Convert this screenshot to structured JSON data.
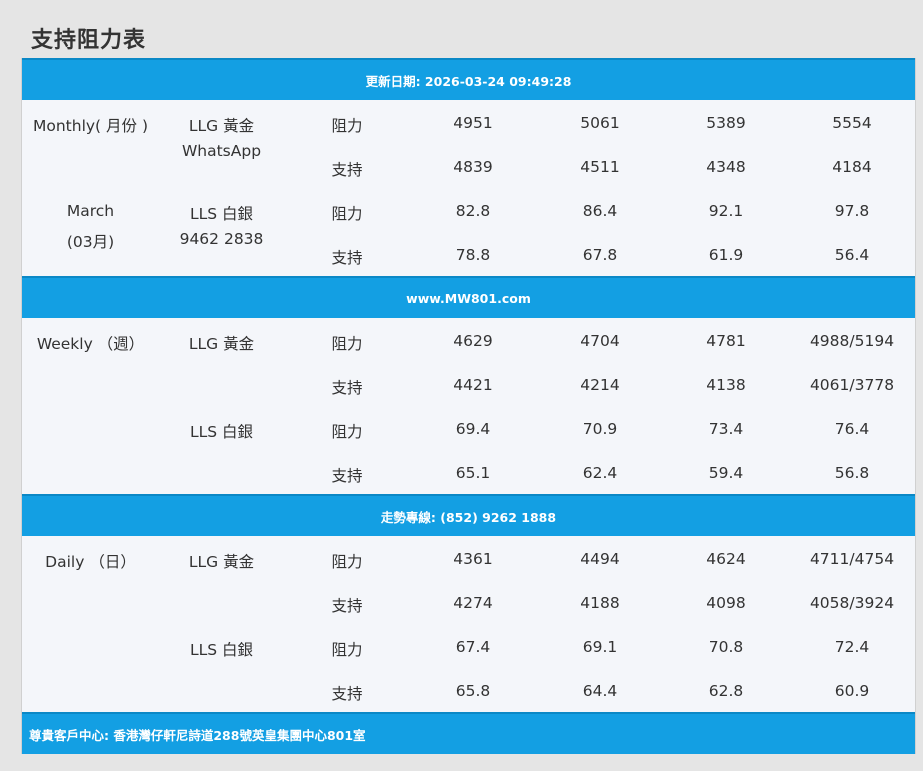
{
  "page_title": "支持阻力表",
  "update_banner": "更新日期: 2026-03-24 09:49:28",
  "website_banner": "www.MW801.com",
  "hotline_banner": "走勢專線: (852) 9262 1888",
  "footer_banner": "尊貴客戶中心: 香港灣仔軒尼詩道288號英皇集團中心801室",
  "monthly": {
    "period_label": "Monthly( 月份 )",
    "month_label": "March",
    "month_sub": "(03月)",
    "llg_label": "LLG 黃金",
    "llg_sub": "WhatsApp",
    "lls_label": "LLS 白銀",
    "lls_sub": "9462 2838",
    "rows": [
      {
        "type": "阻力",
        "v": [
          "4951",
          "5061",
          "5389",
          "5554"
        ]
      },
      {
        "type": "支持",
        "v": [
          "4839",
          "4511",
          "4348",
          "4184"
        ]
      },
      {
        "type": "阻力",
        "v": [
          "82.8",
          "86.4",
          "92.1",
          "97.8"
        ]
      },
      {
        "type": "支持",
        "v": [
          "78.8",
          "67.8",
          "61.9",
          "56.4"
        ]
      }
    ]
  },
  "weekly": {
    "period_label": "Weekly （週）",
    "llg_label": "LLG 黃金",
    "lls_label": "LLS 白銀",
    "rows": [
      {
        "type": "阻力",
        "v": [
          "4629",
          "4704",
          "4781",
          "4988/5194"
        ]
      },
      {
        "type": "支持",
        "v": [
          "4421",
          "4214",
          "4138",
          "4061/3778"
        ]
      },
      {
        "type": "阻力",
        "v": [
          "69.4",
          "70.9",
          "73.4",
          "76.4"
        ]
      },
      {
        "type": "支持",
        "v": [
          "65.1",
          "62.4",
          "59.4",
          "56.8"
        ]
      }
    ]
  },
  "daily": {
    "period_label": "Daily （日）",
    "llg_label": "LLG 黃金",
    "lls_label": "LLS 白銀",
    "rows": [
      {
        "type": "阻力",
        "v": [
          "4361",
          "4494",
          "4624",
          "4711/4754"
        ]
      },
      {
        "type": "支持",
        "v": [
          "4274",
          "4188",
          "4098",
          "4058/3924"
        ]
      },
      {
        "type": "阻力",
        "v": [
          "67.4",
          "69.1",
          "70.8",
          "72.4"
        ]
      },
      {
        "type": "支持",
        "v": [
          "65.8",
          "64.4",
          "62.8",
          "60.9"
        ]
      }
    ]
  }
}
